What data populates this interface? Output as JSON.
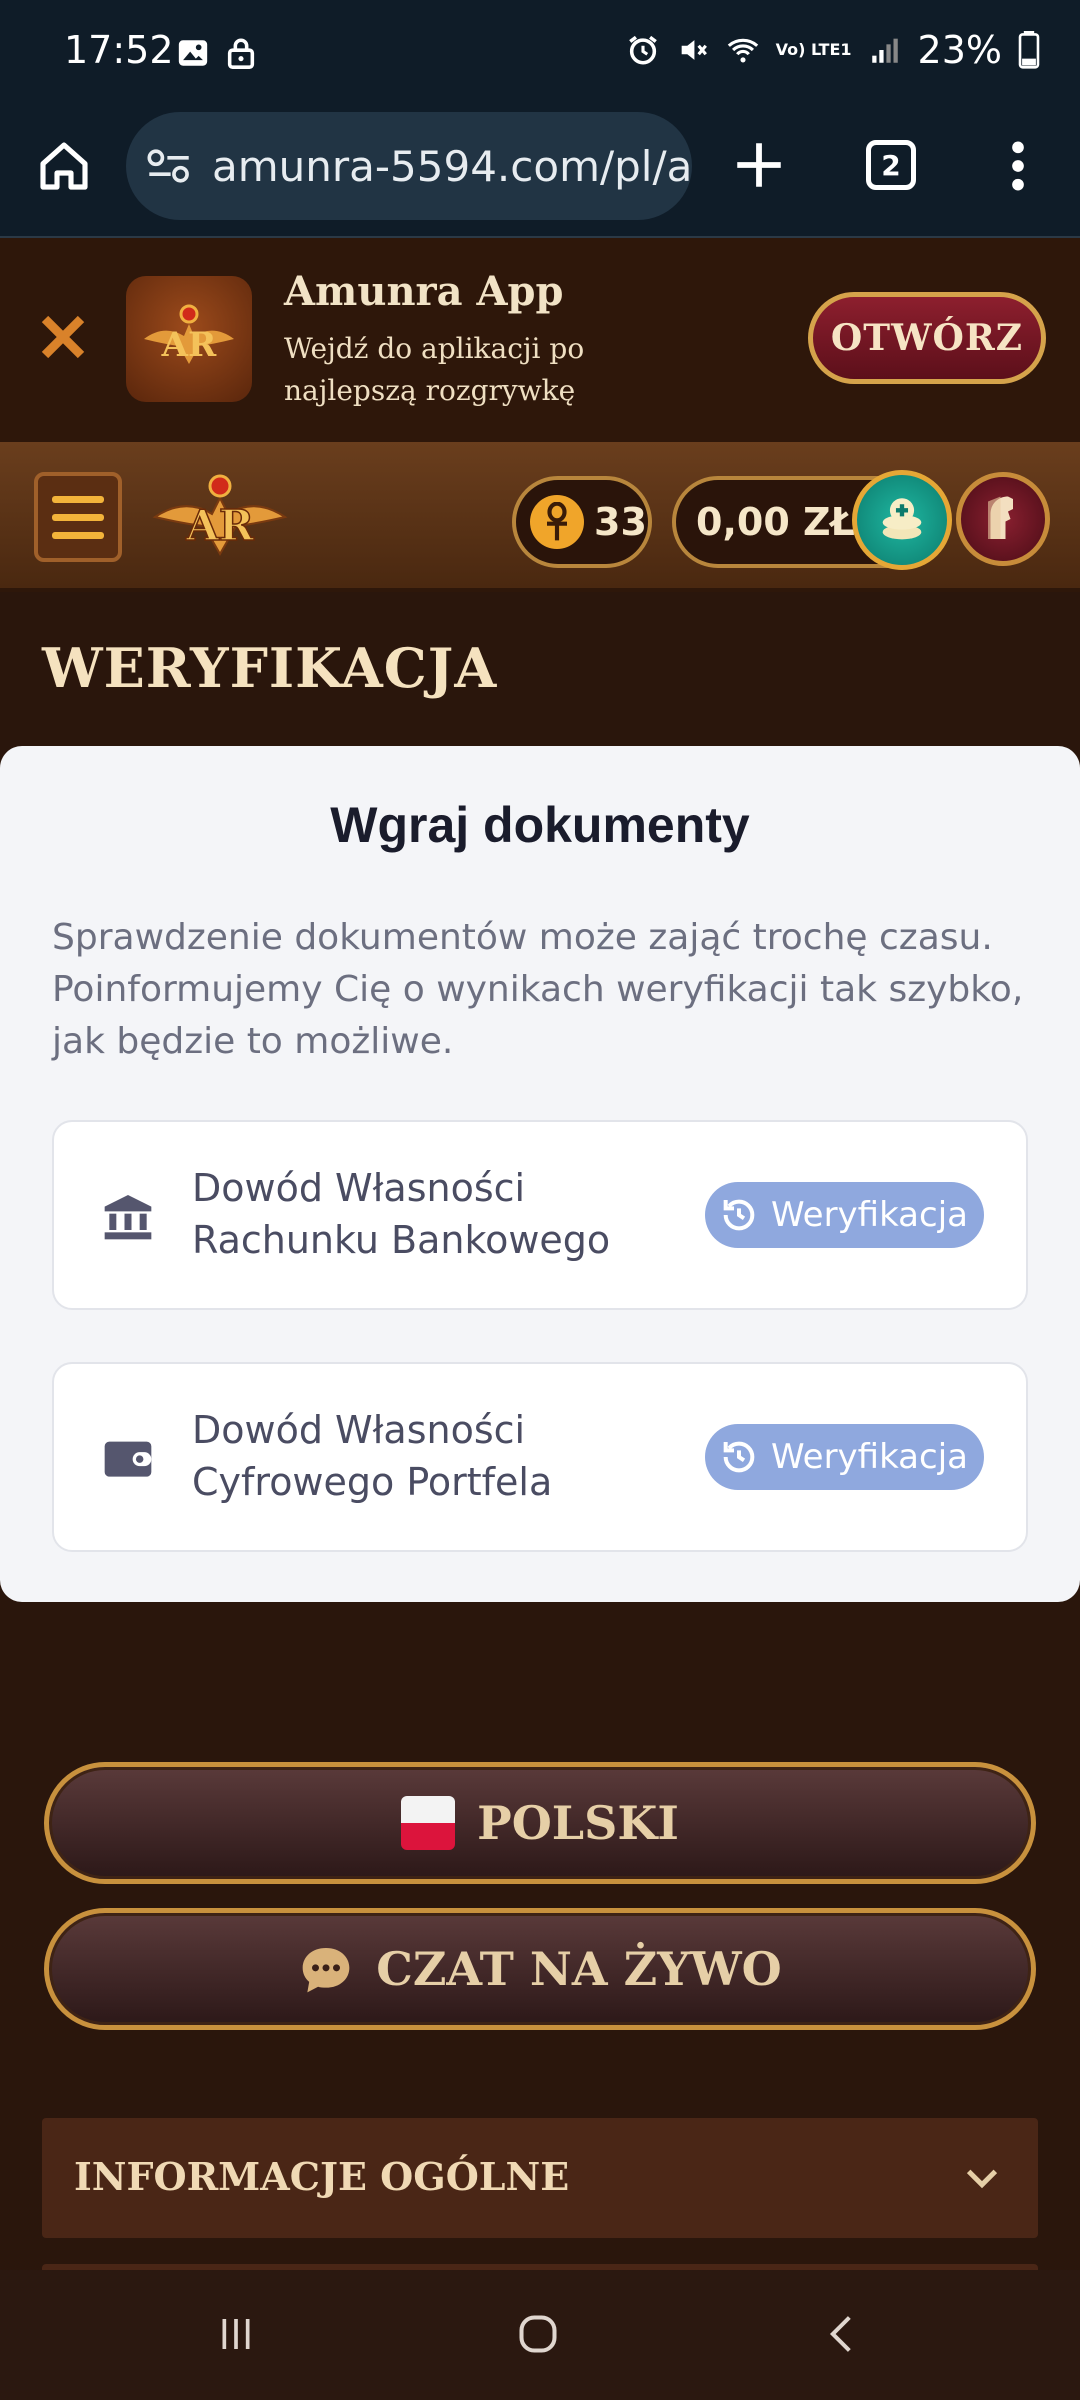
{
  "status_bar": {
    "time": "17:52",
    "battery": "23%",
    "network": "Vo) LTE1"
  },
  "browser": {
    "url": "amunra-5594.com/pl/a",
    "tab_count": "2"
  },
  "app_banner": {
    "title": "Amunra App",
    "subtitle": "Wejdź do aplikacji po najlepszą rozgrywkę",
    "open_label": "OTWÓRZ"
  },
  "header": {
    "points": "33",
    "balance": "0,00 ZŁ"
  },
  "page": {
    "title": "WERYFIKACJA"
  },
  "documents": {
    "title": "Wgraj dokumenty",
    "description": "Sprawdzenie dokumentów może zająć trochę czasu. Poinformujemy Cię o wynikach weryfikacji tak szybko, jak będzie to możliwe.",
    "items": [
      {
        "label": "Dowód Własności Rachunku Bankowego",
        "status": "Weryfikacja",
        "icon": "bank-icon"
      },
      {
        "label": "Dowód Własności Cyfrowego Portfela",
        "status": "Weryfikacja",
        "icon": "wallet-icon"
      }
    ]
  },
  "footer": {
    "language_label": "POLSKI",
    "chat_label": "CZAT NA ŻYWO",
    "info_section": "INFORMACJE OGÓLNE"
  },
  "colors": {
    "accent_gold": "#c8913d",
    "badge_blue": "#8fa8de",
    "background_brown": "#2a160c"
  }
}
